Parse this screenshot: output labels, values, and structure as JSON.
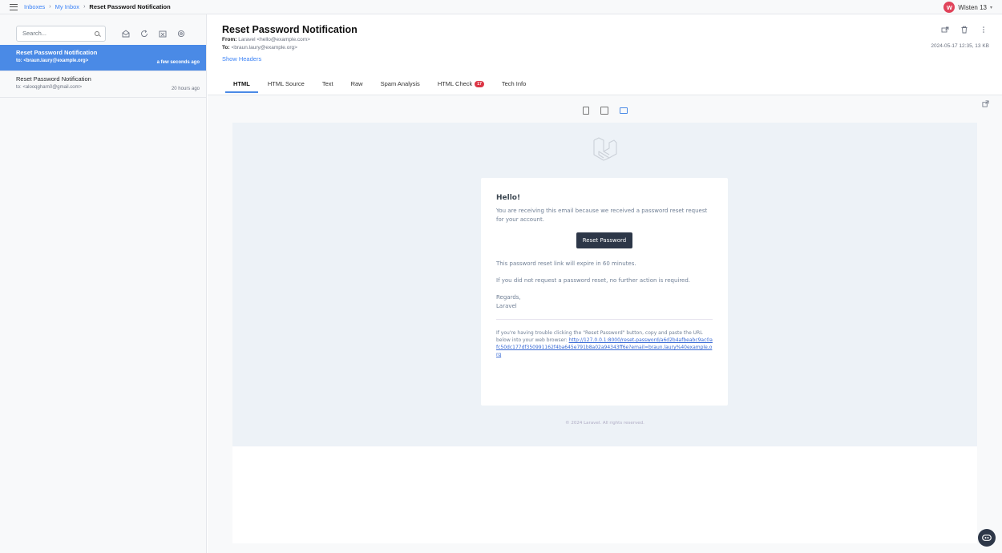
{
  "breadcrumb": {
    "items": [
      "Inboxes",
      "My Inbox"
    ],
    "current": "Reset Password Notification",
    "separator": "›"
  },
  "user": {
    "initial": "W",
    "name": "Wisten 13"
  },
  "sidebar": {
    "search_placeholder": "Search...",
    "messages": [
      {
        "subject": "Reset Password Notification",
        "to": "to: <braun.laury@example.org>",
        "time": "a few seconds ago",
        "active": true
      },
      {
        "subject": "Reset Password Notification",
        "to": "to: <alooqgharn0@gmail.com>",
        "time": "20 hours ago",
        "active": false
      }
    ]
  },
  "message": {
    "subject": "Reset Password Notification",
    "from_label": "From:",
    "from": "Laravel <hello@example.com>",
    "to_label": "To:",
    "to": "<braun.laury@example.org>",
    "show_headers": "Show Headers",
    "date_size": "2024-05-17 12:35, 13 KB"
  },
  "tabs": [
    {
      "label": "HTML",
      "active": true
    },
    {
      "label": "HTML Source"
    },
    {
      "label": "Text"
    },
    {
      "label": "Raw"
    },
    {
      "label": "Spam Analysis"
    },
    {
      "label": "HTML Check",
      "badge": "17"
    },
    {
      "label": "Tech Info"
    }
  ],
  "email": {
    "greeting": "Hello!",
    "intro": "You are receiving this email because we received a password reset request for your account.",
    "button": "Reset Password",
    "expire": "This password reset link will expire in 60 minutes.",
    "no_action": "If you did not request a password reset, no further action is required.",
    "regards": "Regards,",
    "sender": "Laravel",
    "subcopy_text": "If you're having trouble clicking the \"Reset Password\" button, copy and paste the URL below into your web browser:",
    "subcopy_url": "http://127.0.0.1:8000/reset-password/a6d2b4afbeabc9ac0afc50dc177df350991162f4ba645e791b8a02a94343ff6e?email=braun.laury%40example.org",
    "footer": "© 2024 Laravel. All rights reserved."
  },
  "colors": {
    "accent": "#4a8ae6",
    "button": "#2d3748",
    "badge": "#dc3545",
    "avatar": "#e0435a"
  },
  "icons": {
    "topbar": [
      "menu-icon"
    ],
    "sidebar_toolbar": [
      "mark-read-icon",
      "refresh-icon",
      "delete-all-icon",
      "settings-icon"
    ],
    "message_actions": [
      "release-icon",
      "delete-icon",
      "more-icon"
    ],
    "devices": [
      "phone-icon",
      "tablet-icon",
      "desktop-icon"
    ]
  }
}
